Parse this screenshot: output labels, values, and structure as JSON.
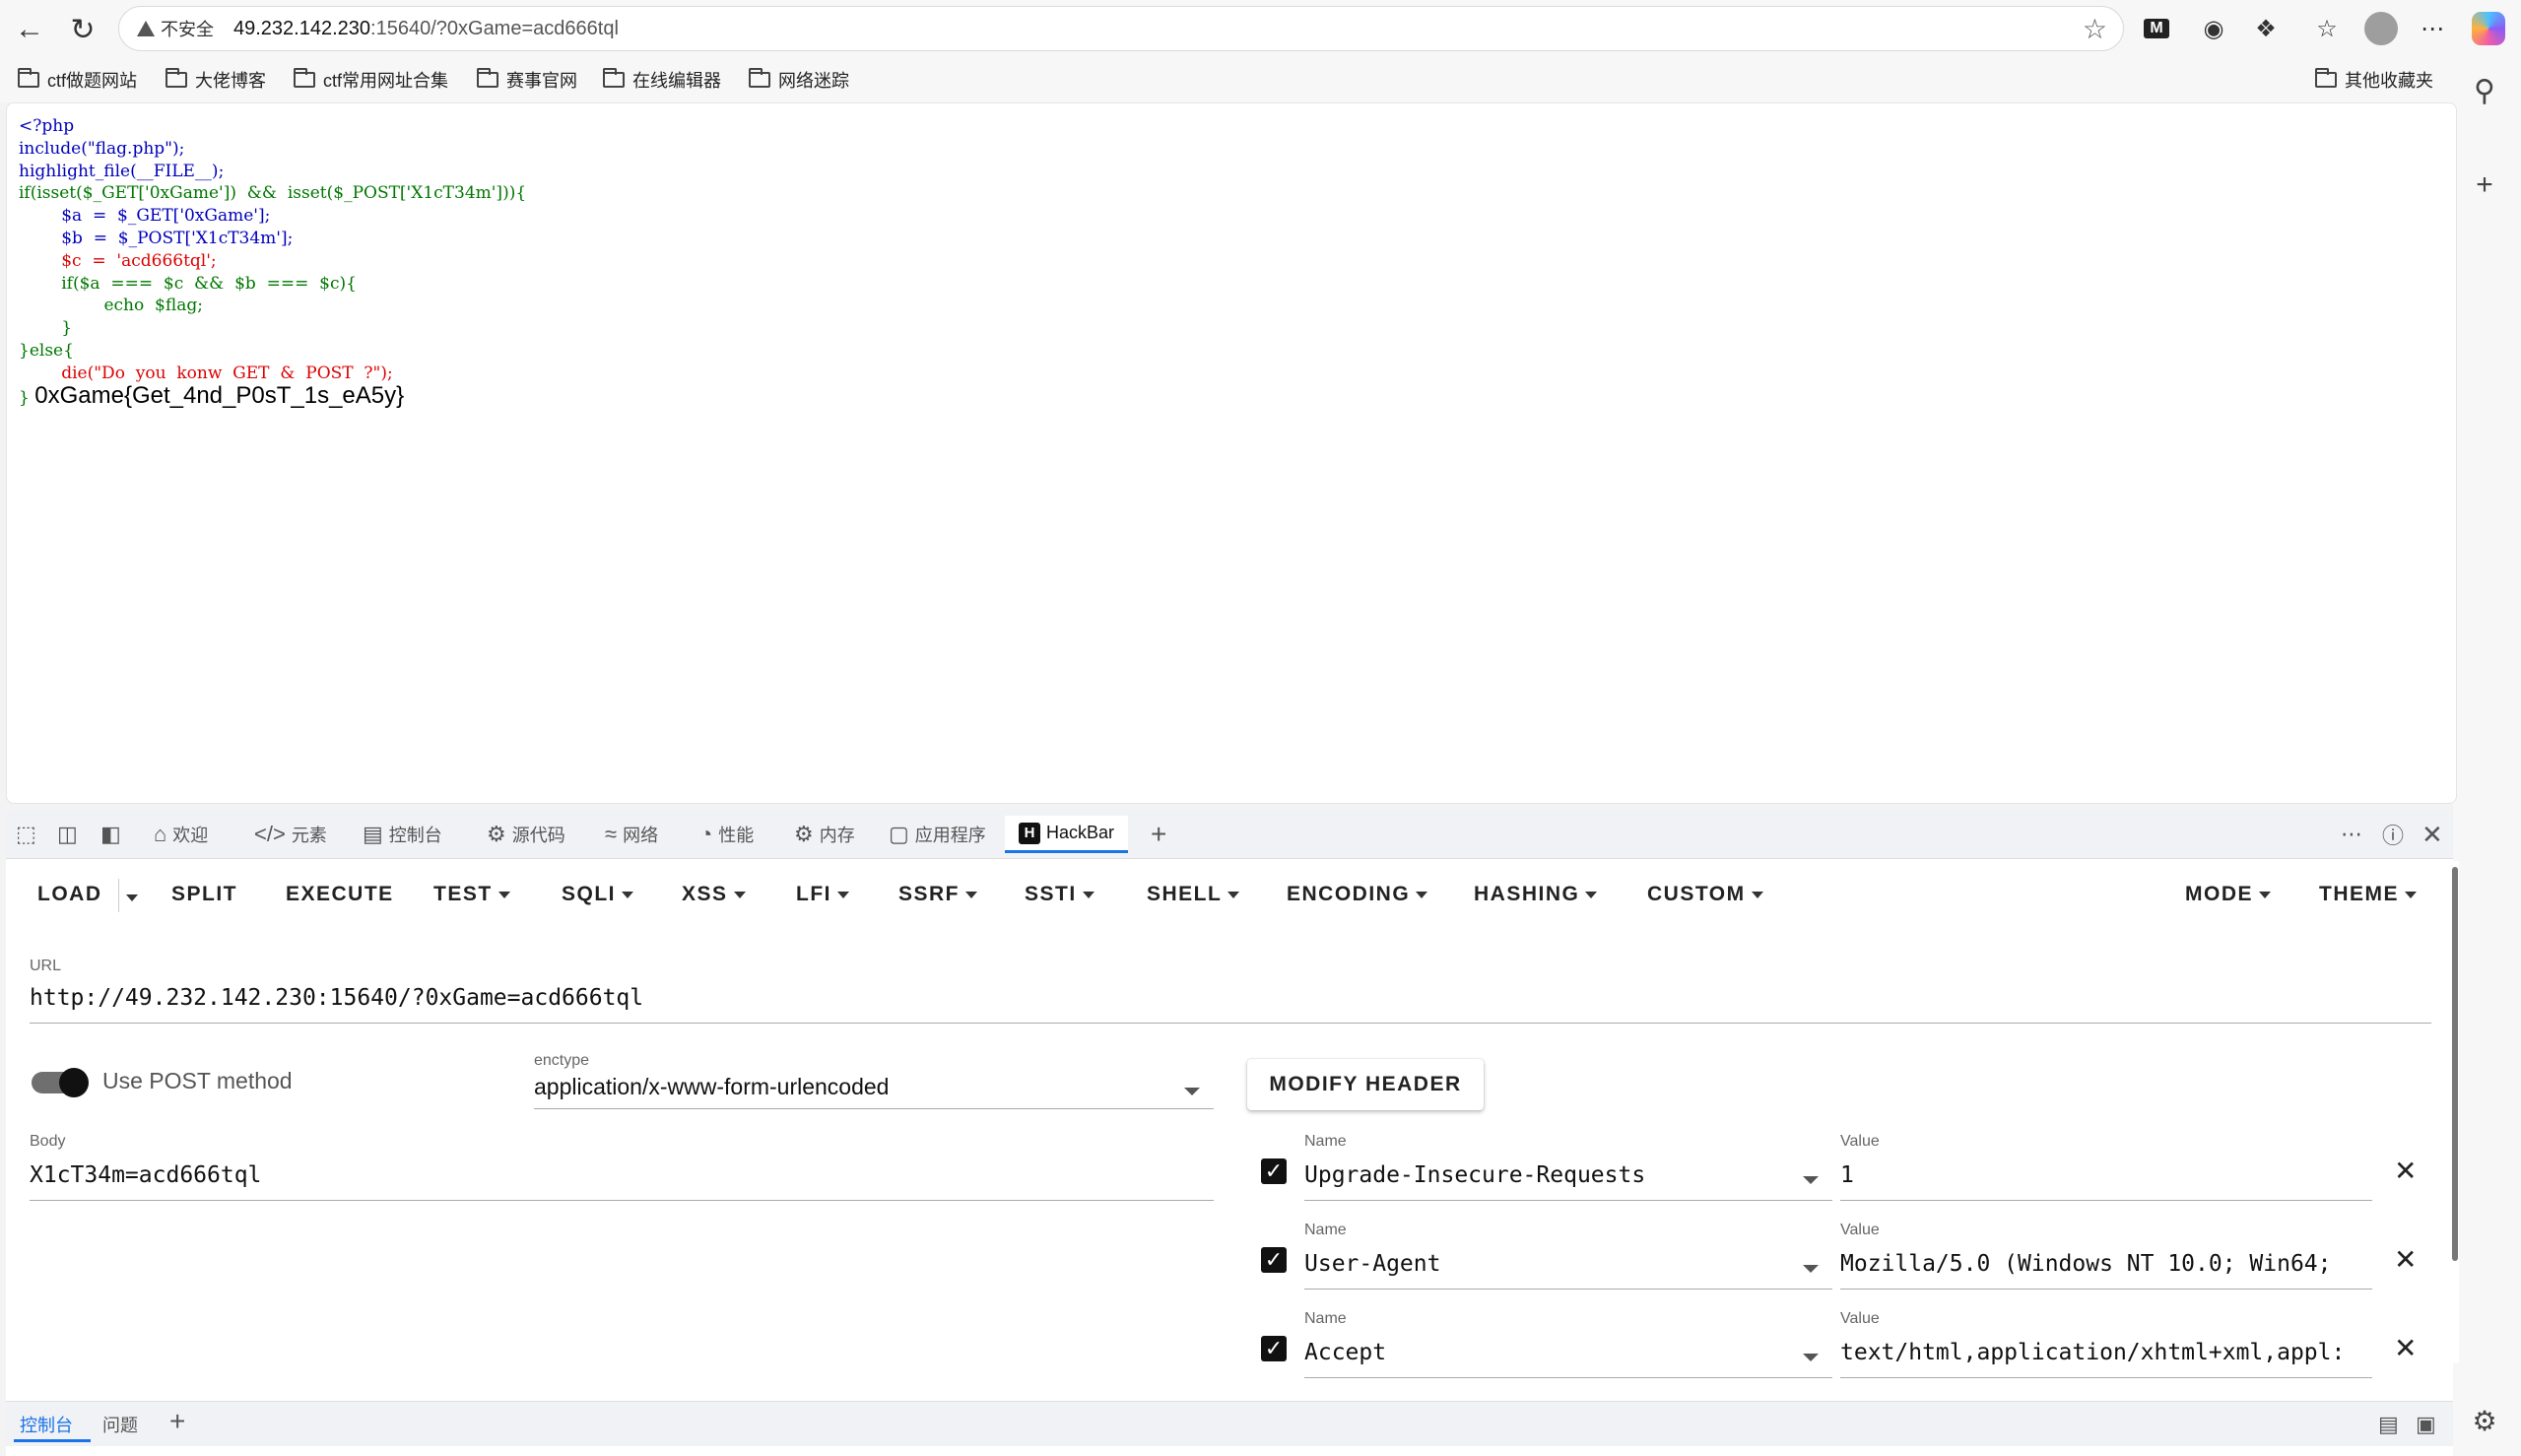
{
  "browser": {
    "security_label": "不安全",
    "url_host": "49.232.142.230",
    "url_rest": ":15640/?0xGame=acd666tql",
    "bookmarks": [
      "ctf做题网站",
      "大佬博客",
      "ctf常用网址合集",
      "赛事官网",
      "在线编辑器",
      "网络迷踪"
    ],
    "other_bookmarks": "其他收藏夹"
  },
  "page": {
    "code_lines": [
      "<?php",
      "include(\"flag.php\");",
      "highlight_file(__FILE__);",
      "if(isset($_GET['0xGame'])  &&  isset($_POST['X1cT34m'])){",
      "        $a  =  $_GET['0xGame'];",
      "        $b  =  $_POST['X1cT34m'];",
      "        $c  =  'acd666tql';",
      "        if($a  ===  $c  &&  $b  ===  $c){",
      "                echo  $flag;",
      "        }",
      "}else{",
      "        die(\"Do  you  konw  GET  &  POST  ?\");",
      "}"
    ],
    "flag": "0xGame{Get_4nd_P0sT_1s_eA5y}"
  },
  "devtools": {
    "tabs": [
      "欢迎",
      "元素",
      "控制台",
      "源代码",
      "网络",
      "性能",
      "内存",
      "应用程序",
      "HackBar"
    ],
    "drawer_tabs": [
      "控制台",
      "问题"
    ]
  },
  "hackbar": {
    "menu": {
      "load": "LOAD",
      "split": "SPLIT",
      "execute": "EXECUTE",
      "test": "TEST",
      "sqli": "SQLI",
      "xss": "XSS",
      "lfi": "LFI",
      "ssrf": "SSRF",
      "ssti": "SSTI",
      "shell": "SHELL",
      "encoding": "ENCODING",
      "hashing": "HASHING",
      "custom": "CUSTOM",
      "mode": "MODE",
      "theme": "THEME"
    },
    "url_label": "URL",
    "url_value": "http://49.232.142.230:15640/?0xGame=acd666tql",
    "use_post_label": "Use POST method",
    "use_post": true,
    "enctype_label": "enctype",
    "enctype_value": "application/x-www-form-urlencoded",
    "modify_header": "MODIFY HEADER",
    "body_label": "Body",
    "body_value": "X1cT34m=acd666tql",
    "header_name_label": "Name",
    "header_value_label": "Value",
    "headers": [
      {
        "name": "Upgrade-Insecure-Requests",
        "value": "1",
        "enabled": true
      },
      {
        "name": "User-Agent",
        "value": "Mozilla/5.0 (Windows NT 10.0; Win64;",
        "enabled": true
      },
      {
        "name": "Accept",
        "value": "text/html,application/xhtml+xml,appl:",
        "enabled": true
      }
    ]
  }
}
